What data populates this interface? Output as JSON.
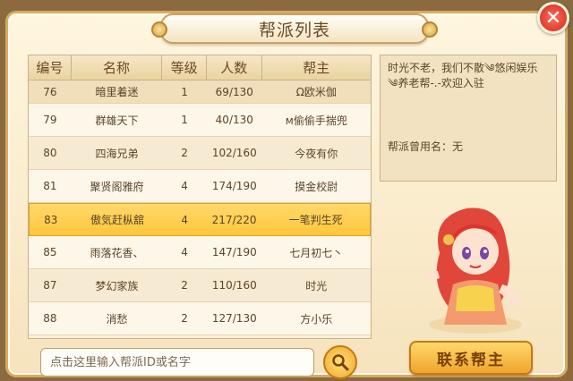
{
  "title": "帮派列表",
  "close_symbol": "✕",
  "table": {
    "headers": [
      "编号",
      "名称",
      "等级",
      "人数",
      "帮主"
    ],
    "rows": [
      {
        "id": "76",
        "name": "暗里着迷",
        "level": "1",
        "members": "69/130",
        "leader": "Ω欧米伽"
      },
      {
        "id": "79",
        "name": "群雄天下",
        "level": "1",
        "members": "40/130",
        "leader": "м偷偷手揣兜"
      },
      {
        "id": "80",
        "name": "四海兄弟",
        "level": "2",
        "members": "102/160",
        "leader": "今夜有你"
      },
      {
        "id": "81",
        "name": "聚贤阁雅府",
        "level": "4",
        "members": "174/190",
        "leader": "摸金校尉"
      },
      {
        "id": "83",
        "name": "傲気赶枞舘",
        "level": "4",
        "members": "217/220",
        "leader": "一笔判生死",
        "selected": true
      },
      {
        "id": "85",
        "name": "雨落花香、",
        "level": "4",
        "members": "147/190",
        "leader": "七月初七丶"
      },
      {
        "id": "87",
        "name": "梦幻家族",
        "level": "2",
        "members": "110/160",
        "leader": "时光"
      },
      {
        "id": "88",
        "name": "消愁",
        "level": "2",
        "members": "127/130",
        "leader": "方小乐"
      }
    ]
  },
  "info": {
    "description": "时光不老，我们不散༄悠闲娱乐༄养老帮-.-欢迎入驻",
    "former_name": "帮派曾用名：无"
  },
  "search": {
    "placeholder": "点击这里输入帮派ID或名字",
    "value": ""
  },
  "contact_button": "联系帮主",
  "icons": {
    "search": "search-icon",
    "close": "close-icon",
    "character": "character-portrait"
  }
}
